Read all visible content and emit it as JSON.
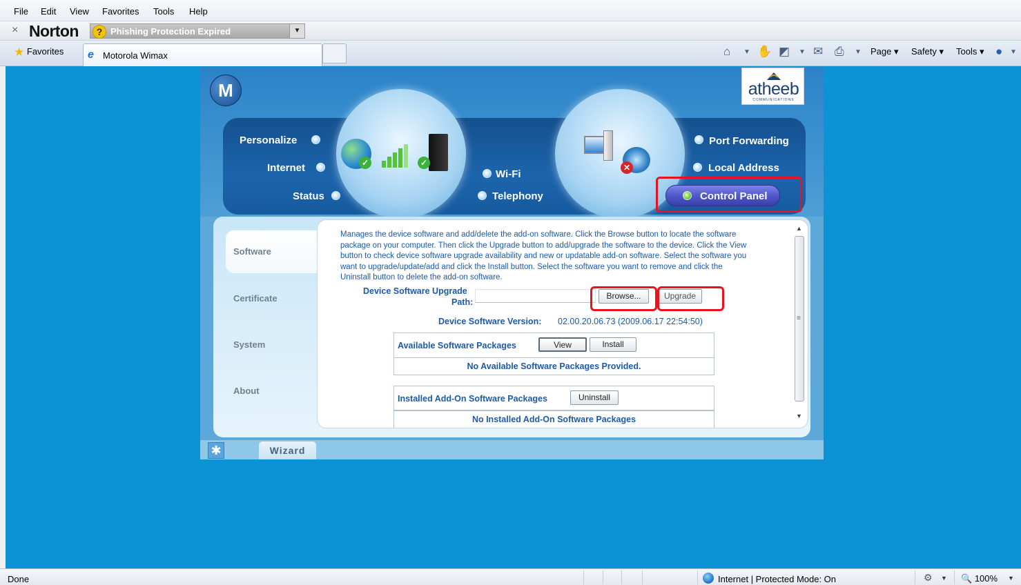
{
  "menubar": {
    "items": [
      "File",
      "Edit",
      "View",
      "Favorites",
      "Tools",
      "Help"
    ]
  },
  "norton": {
    "close": "×",
    "logo": "Norton",
    "phishing_status": "Phishing Protection Expired",
    "icon": "question-icon"
  },
  "tabbar": {
    "favorites": "Favorites",
    "tab_title": "Motorola Wimax",
    "commands": {
      "page": "Page",
      "safety": "Safety",
      "tools": "Tools"
    },
    "icons": [
      "home-icon",
      "hand-icon",
      "rss-icon",
      "mail-icon",
      "print-icon",
      "help-icon"
    ]
  },
  "router": {
    "brand_logo": "motorola-logo",
    "partner_logo": {
      "text": "atheeb",
      "subtext": "COMMUNICATIONS"
    },
    "nav": {
      "personalize": "Personalize",
      "internet": "Internet",
      "status": "Status",
      "wifi": "Wi-Fi",
      "telephony": "Telephony",
      "port_forwarding": "Port Forwarding",
      "local_address": "Local Address",
      "control_panel": "Control Panel"
    },
    "sidebar": {
      "items": [
        {
          "label": "Software"
        },
        {
          "label": "Certificate"
        },
        {
          "label": "System"
        },
        {
          "label": "About"
        }
      ],
      "active": "Software"
    },
    "software": {
      "description": "Manages the device software and add/delete the add-on software. Click the Browse button to locate the software package on your computer. Then click the Upgrade button to add/upgrade the software to the device. Click the View button to check device software upgrade availability and new or updatable add-on software. Select the software you want to upgrade/update/add and click the Install button. Select the software you want to remove and click the Uninstall button to delete the add-on software.",
      "upgrade_path_label_1": "Device Software Upgrade",
      "upgrade_path_label_2": "Path:",
      "upgrade_path_value": "",
      "browse_label": "Browse...",
      "upgrade_label": "Upgrade",
      "version_label": "Device Software Version:",
      "version_value": "02.00.20.06.73 (2009.06.17 22:54:50)",
      "available": {
        "title": "Available Software Packages",
        "view_label": "View",
        "install_label": "Install",
        "message": "No Available Software Packages Provided."
      },
      "installed": {
        "title": "Installed Add-On Software Packages",
        "uninstall_label": "Uninstall",
        "message": "No Installed Add-On Software Packages"
      }
    },
    "wizard_label": "Wizard"
  },
  "statusbar": {
    "status": "Done",
    "zone": "Internet | Protected Mode: On",
    "zoom": "100%"
  },
  "colors": {
    "page_background": "#0b93d6",
    "highlight": "#e8131f",
    "text_blue": "#1d5aa8",
    "nav_bar": "#1c65ac"
  }
}
